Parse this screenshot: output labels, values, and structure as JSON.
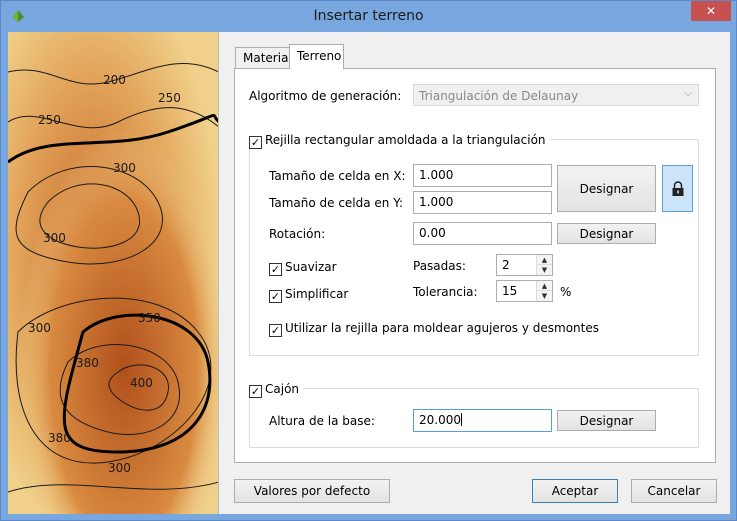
{
  "window": {
    "title": "Insertar terreno",
    "close_glyph": "✕"
  },
  "preview": {
    "contour_labels": [
      "250",
      "200",
      "250",
      "300",
      "300",
      "300",
      "350",
      "400",
      "380",
      "300",
      "380"
    ]
  },
  "tabs": [
    {
      "label": "Material",
      "active": false
    },
    {
      "label": "Terreno",
      "active": true
    }
  ],
  "algorithm": {
    "label": "Algoritmo de generación:",
    "value": "Triangulación de Delaunay"
  },
  "grid": {
    "checked": true,
    "label": "Rejilla rectangular amoldada a la triangulación",
    "cell_x_label": "Tamaño de celda en X:",
    "cell_x_value": "1.000",
    "cell_y_label": "Tamaño de celda en Y:",
    "cell_y_value": "1.000",
    "design_cells_label": "Designar",
    "lock_icon": "lock-icon",
    "rotation_label": "Rotación:",
    "rotation_value": "0.00",
    "design_rotation_label": "Designar",
    "smooth": {
      "checked": true,
      "label": "Suavizar"
    },
    "passes_label": "Pasadas:",
    "passes_value": "2",
    "simplify": {
      "checked": true,
      "label": "Simplificar"
    },
    "tolerance_label": "Tolerancia:",
    "tolerance_value": "15",
    "tolerance_unit": "%",
    "use_grid": {
      "checked": true,
      "label": "Utilizar la rejilla para moldear agujeros y desmontes"
    }
  },
  "box": {
    "checked": true,
    "label": "Cajón",
    "base_height_label": "Altura de la base:",
    "base_height_value": "20.000",
    "design_label": "Designar"
  },
  "footer": {
    "defaults_label": "Valores por defecto",
    "accept_label": "Aceptar",
    "cancel_label": "Cancelar"
  },
  "colors": {
    "titlebar": "#78a6df",
    "close": "#c75050",
    "terrain_low": "#e8c070",
    "terrain_high": "#b05a20"
  }
}
